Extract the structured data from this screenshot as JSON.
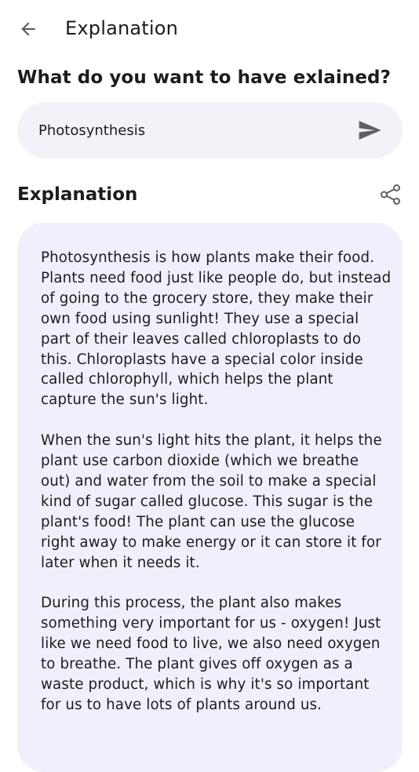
{
  "app_bar": {
    "title": "Explanation",
    "back_icon": "arrow-back-icon"
  },
  "prompt": {
    "question": "What do you want to have exlained?",
    "input_value": "Photosynthesis",
    "send_icon": "send-icon"
  },
  "result": {
    "title": "Explanation",
    "share_icon": "share-icon",
    "paragraphs": [
      "Photosynthesis is how plants make their food. Plants need food just like people do, but instead of going to the grocery store, they make their own food using sunlight! They use a special part of their leaves called chloroplasts to do this. Chloroplasts have a special color inside called chlorophyll, which helps the plant capture the sun's light.",
      "When the sun's light hits the plant, it helps the plant use carbon dioxide (which we breathe out) and water from the soil to make a special kind of sugar called glucose. This sugar is the plant's food! The plant can use the glucose right away to make energy or it can store it for later when it needs it.",
      "During this process, the plant also makes something very important for us - oxygen! Just like we need food to live, we also need oxygen to breathe. The plant gives off oxygen as a waste product, which is why it's so important for us to have lots of plants around us."
    ]
  },
  "colors": {
    "input_background": "#f2f2f8",
    "card_background": "#eff0fb",
    "icon": "#5f5f66",
    "text": "#1c1b1f"
  }
}
